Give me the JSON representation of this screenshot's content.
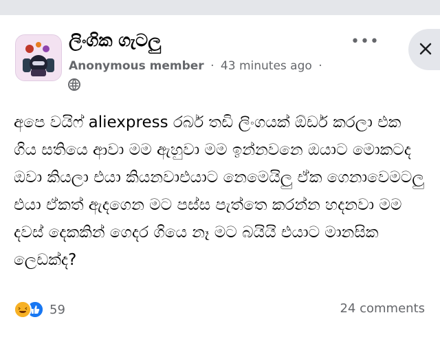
{
  "post": {
    "group_name": "ලිංගික ගැටලු",
    "author": "Anonymous member",
    "timestamp": "43 minutes ago",
    "separator": "·",
    "more_label": "•••",
    "body": "අපෙ වයිෆ් aliexpress රබර් තඩි ලිංගයක් ඕඩර් කරලා එක ගිය සතියෙ ආවා මම ඇහුවා මම ඉන්නවනෙ ඔයාට මොකටද ඔවා කියලා එයා කියනවාඑයාට නෙමෙයිලු ඒක ගෙනාවෙමටලු එයා ඒකත් ඇදගෙන මට පස්ස පැත්තෙ කරන්න හදනවා මම දවස් දෙකකින් ගෙදර ගියෙ නෑ මට බයියි එයාට මානසික ලෙඩක්ද?",
    "reaction_count": "59",
    "comments_label": "24 comments"
  },
  "icons": {
    "globe": "globe-icon",
    "more": "more-icon",
    "close": "close-icon",
    "haha": "haha-reaction-icon",
    "like": "like-reaction-icon"
  },
  "colors": {
    "text": "#050505",
    "meta": "#65676b",
    "like_blue": "#1877f2",
    "haha_yellow": "#f7b125",
    "strip": "#e4e6ea"
  }
}
